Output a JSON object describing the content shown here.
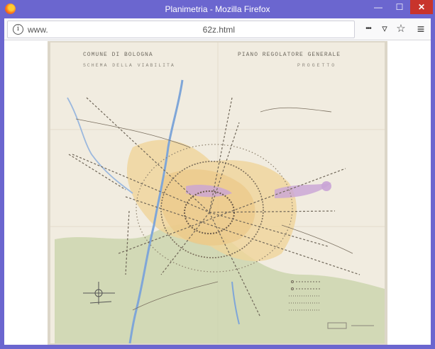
{
  "window": {
    "title": "Planimetria - Mozilla Firefox",
    "min_label": "—",
    "max_label": "☐",
    "close_label": "✕"
  },
  "navbar": {
    "url_prefix": "www.",
    "url_suffix": "62z.html",
    "info_glyph": "i",
    "more_glyph": "•••",
    "pocket_glyph": "▿",
    "star_glyph": "☆",
    "menu_glyph": "≡"
  },
  "map": {
    "title_left_1": "COMUNE DI BOLOGNA",
    "title_left_2": "SCHEMA DELLA VIABILITA",
    "title_right_1": "PIANO REGOLATORE GENERALE",
    "title_right_2": "PROGETTO",
    "colors": {
      "paper": "#f1ece0",
      "river": "#7fa6d8",
      "hills": "#c7d3a8",
      "urban": "#f0d49a",
      "violet": "#c9a4d6",
      "roads": "#7a6d5a"
    }
  }
}
